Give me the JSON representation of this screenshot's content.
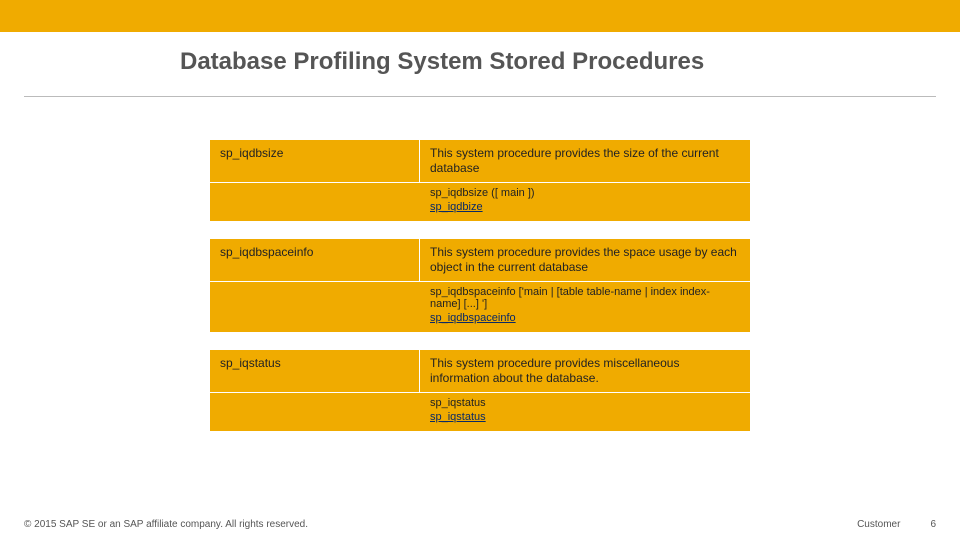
{
  "title": "Database Profiling System Stored Procedures",
  "rows": [
    {
      "name": "sp_iqdbsize",
      "desc": "This system procedure provides the size of the current database",
      "syntax": "sp_iqdbsize ([ main ])",
      "link": "sp_iqdbize"
    },
    {
      "name": "sp_iqdbspaceinfo",
      "desc": "This system procedure provides the space usage by each object in the current database",
      "syntax": "sp_iqdbspaceinfo ['main | [table table-name | index index-name] [...] ']",
      "link": "sp_iqdbspaceinfo"
    },
    {
      "name": "sp_iqstatus",
      "desc": "This system procedure provides miscellaneous information about the database.",
      "syntax": "sp_iqstatus",
      "link": "sp_iqstatus"
    }
  ],
  "footer": {
    "copyright": "© 2015 SAP SE or an SAP affiliate company. All rights reserved.",
    "label": "Customer",
    "page": "6"
  }
}
